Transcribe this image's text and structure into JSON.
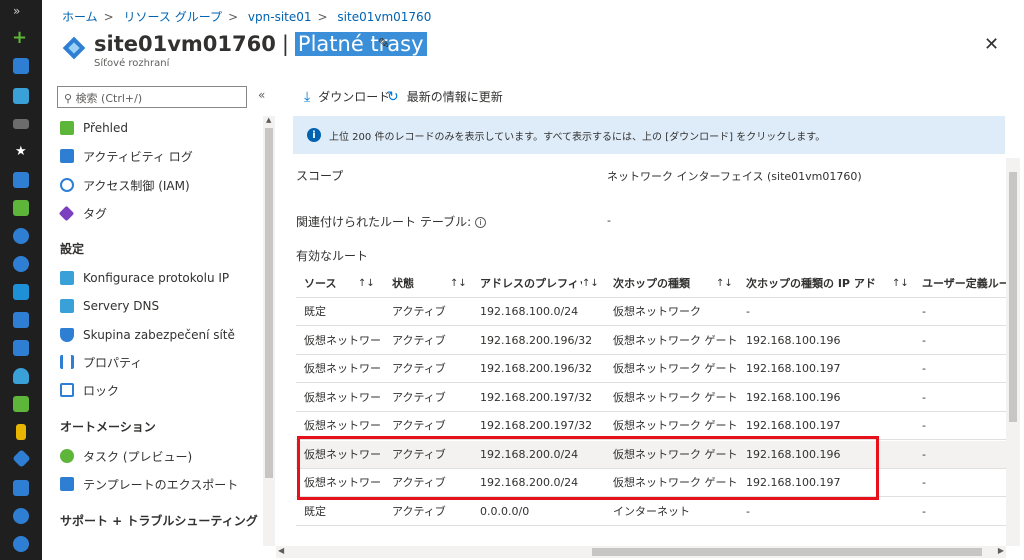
{
  "colors": {
    "accent": "#0078d4",
    "link": "#0063b1",
    "highlight_box": "#e8111b",
    "title_highlight": "#3b8fd8",
    "info_bg": "#deecf9"
  },
  "breadcrumb": [
    "ホーム",
    "リソース グループ",
    "vpn-site01",
    "site01vm01760"
  ],
  "header": {
    "resource_name": "site01vm01760",
    "separator": "|",
    "blade_title": "Platné trasy",
    "subtitle": "Síťové rozhraní"
  },
  "sidebar": {
    "search_placeholder": "検索 (Ctrl+/)",
    "collapse_glyph": "«",
    "items_top": [
      {
        "label": "Přehled",
        "icon": "overview-icon"
      },
      {
        "label": "アクティビティ ログ",
        "icon": "activity-log-icon"
      },
      {
        "label": "アクセス制御 (IAM)",
        "icon": "iam-icon"
      },
      {
        "label": "タグ",
        "icon": "tag-icon"
      }
    ],
    "section_settings": "設定",
    "items_settings": [
      {
        "label": "Konfigurace protokolu IP",
        "icon": "ip-config-icon"
      },
      {
        "label": "Servery DNS",
        "icon": "dns-icon"
      },
      {
        "label": "Skupina zabezpečení sítě",
        "icon": "nsg-shield-icon"
      },
      {
        "label": "プロパティ",
        "icon": "properties-icon"
      },
      {
        "label": "ロック",
        "icon": "lock-icon"
      }
    ],
    "section_automation": "オートメーション",
    "items_automation": [
      {
        "label": "タスク (プレビュー)",
        "icon": "tasks-icon"
      },
      {
        "label": "テンプレートのエクスポート",
        "icon": "export-template-icon"
      }
    ],
    "section_support": "サポート + トラブルシューティング"
  },
  "toolbar": {
    "download": "ダウンロード",
    "refresh": "最新の情報に更新"
  },
  "info_banner": "上位 200 件のレコードのみを表示しています。すべて表示するには、上の [ダウンロード] をクリックします。",
  "scope": {
    "label": "スコープ",
    "value": "ネットワーク インターフェイス (site01vm01760)"
  },
  "route_table": {
    "label": "関連付けられたルート テーブル:",
    "value": "-"
  },
  "effective_routes_title": "有効なルート",
  "table": {
    "columns": [
      "ソース",
      "状態",
      "アドレスのプレフィック...",
      "次ホップの種類",
      "次ホップの種類の IP アドレス",
      "ユーザー定義ルート..."
    ],
    "sort_glyph": "↑↓",
    "rows": [
      [
        "既定",
        "アクティブ",
        "192.168.100.0/24",
        "仮想ネットワーク",
        "-",
        "-"
      ],
      [
        "仮想ネットワー...",
        "アクティブ",
        "192.168.200.196/32",
        "仮想ネットワーク ゲートウ...",
        "192.168.100.196",
        "-"
      ],
      [
        "仮想ネットワー...",
        "アクティブ",
        "192.168.200.196/32",
        "仮想ネットワーク ゲートウ...",
        "192.168.100.197",
        "-"
      ],
      [
        "仮想ネットワー...",
        "アクティブ",
        "192.168.200.197/32",
        "仮想ネットワーク ゲートウ...",
        "192.168.100.196",
        "-"
      ],
      [
        "仮想ネットワー...",
        "アクティブ",
        "192.168.200.197/32",
        "仮想ネットワーク ゲートウ...",
        "192.168.100.197",
        "-"
      ],
      [
        "仮想ネットワー...",
        "アクティブ",
        "192.168.200.0/24",
        "仮想ネットワーク ゲートウ...",
        "192.168.100.196",
        "-"
      ],
      [
        "仮想ネットワー...",
        "アクティブ",
        "192.168.200.0/24",
        "仮想ネットワーク ゲートウ...",
        "192.168.100.197",
        "-"
      ],
      [
        "既定",
        "アクティブ",
        "0.0.0.0/0",
        "インターネット",
        "-",
        "-"
      ]
    ]
  }
}
